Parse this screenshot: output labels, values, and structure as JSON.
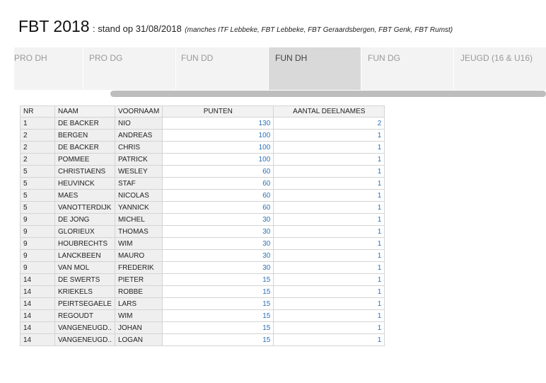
{
  "header": {
    "title": "FBT 2018",
    "subtitle": ": stand op 31/08/2018",
    "note": "(manches ITF Lebbeke, FBT Lebbeke, FBT Geraardsbergen, FBT Genk, FBT Rumst)"
  },
  "tabs": [
    {
      "label": "PRO DH",
      "active": false
    },
    {
      "label": "PRO DG",
      "active": false
    },
    {
      "label": "FUN DD",
      "active": false
    },
    {
      "label": "FUN DH",
      "active": true
    },
    {
      "label": "FUN DG",
      "active": false
    },
    {
      "label": "JEUGD (16 & U16)",
      "active": false
    }
  ],
  "table": {
    "columns": [
      "NR",
      "NAAM",
      "VOORNAAM",
      "PUNTEN",
      "AANTAL DEELNAMES"
    ],
    "rows": [
      [
        "1",
        "DE BACKER",
        "NIO",
        "130",
        "2"
      ],
      [
        "2",
        "BERGEN",
        "ANDREAS",
        "100",
        "1"
      ],
      [
        "2",
        "DE BACKER",
        "CHRIS",
        "100",
        "1"
      ],
      [
        "2",
        "POMMEE",
        "PATRICK",
        "100",
        "1"
      ],
      [
        "5",
        "CHRISTIAENS",
        "WESLEY",
        "60",
        "1"
      ],
      [
        "5",
        "HEUVINCK",
        "STAF",
        "60",
        "1"
      ],
      [
        "5",
        "MAES",
        "NICOLAS",
        "60",
        "1"
      ],
      [
        "5",
        "VANOTTERDIJK",
        "YANNICK",
        "60",
        "1"
      ],
      [
        "9",
        "DE JONG",
        "MICHEL",
        "30",
        "1"
      ],
      [
        "9",
        "GLORIEUX",
        "THOMAS",
        "30",
        "1"
      ],
      [
        "9",
        "HOUBRECHTS",
        "WIM",
        "30",
        "1"
      ],
      [
        "9",
        "LANCKBEEN",
        "MAURO",
        "30",
        "1"
      ],
      [
        "9",
        "VAN MOL",
        "FREDERIK",
        "30",
        "1"
      ],
      [
        "14",
        "DE SWERTS",
        "PIETER",
        "15",
        "1"
      ],
      [
        "14",
        "KRIEKELS",
        "ROBBE",
        "15",
        "1"
      ],
      [
        "14",
        "PEIRTSEGAELE",
        "LARS",
        "15",
        "1"
      ],
      [
        "14",
        "REGOUDT",
        "WIM",
        "15",
        "1"
      ],
      [
        "14",
        "VANGENEUGD..",
        "JOHAN",
        "15",
        "1"
      ],
      [
        "14",
        "VANGENEUGD..",
        "LOGAN",
        "15",
        "1"
      ]
    ]
  },
  "colors": {
    "number_text": "#2a6fb6",
    "active_tab": "#d9d9d9",
    "inactive_tab": "#f3f3f3"
  }
}
